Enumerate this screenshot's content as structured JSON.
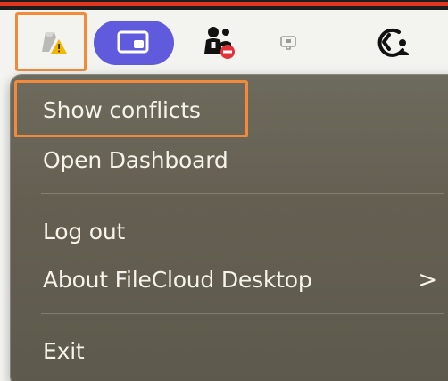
{
  "menubar": {
    "icons": [
      {
        "name": "filecloud-warning-icon",
        "selected": true
      },
      {
        "name": "screen-share-icon",
        "accent": "#5f5bdc"
      },
      {
        "name": "user-blocked-icon"
      },
      {
        "name": "monitor-icon"
      },
      {
        "name": "account-sync-icon"
      }
    ]
  },
  "menu": {
    "items": [
      {
        "label": "Show conflicts",
        "highlighted": true
      },
      {
        "label": "Open Dashboard"
      },
      {
        "label": "Log out"
      },
      {
        "label": "About FileCloud Desktop",
        "submenu_indicator": ">"
      },
      {
        "label": "Exit"
      }
    ]
  },
  "colors": {
    "highlight": "#f28a3c",
    "menu_bg": "#655f52",
    "menu_text": "#f5f3ea",
    "top_red": "#e0351f",
    "pill": "#5f5bdc"
  }
}
